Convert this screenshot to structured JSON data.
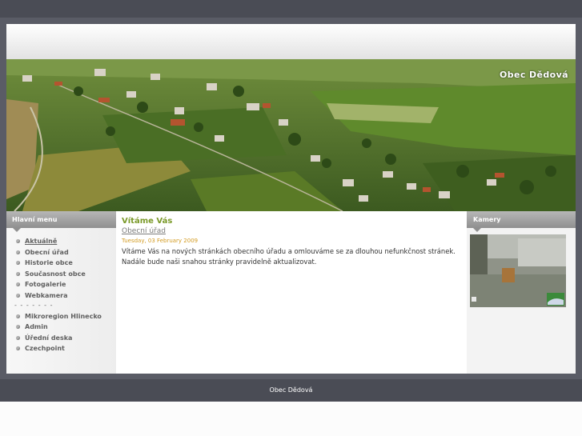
{
  "header": {
    "site_title": "Obec Dědová"
  },
  "sidebar": {
    "title": "Hlavní menu",
    "items": [
      {
        "label": "Aktuálně",
        "active": true
      },
      {
        "label": "Obecní úřad"
      },
      {
        "label": "Historie obce"
      },
      {
        "label": "Současnost obce"
      },
      {
        "label": "Fotogalerie"
      },
      {
        "label": "Webkamera"
      },
      {
        "label": "- - - - - - -",
        "separator": true
      },
      {
        "label": "Mikroregion Hlinecko"
      },
      {
        "label": "Admin"
      },
      {
        "label": "Úřední deska"
      },
      {
        "label": "Czechpoint"
      }
    ]
  },
  "article": {
    "title": "Vítáme Vás",
    "category": "Obecní úřad",
    "date": "Tuesday, 03 February 2009",
    "body": "Vítáme Vás na nových stránkách obecního úřadu  a omlouváme se za dlouhou nefunkčnost stránek. Nadále bude naši snahou stránky pravidelně aktualizovat."
  },
  "right_panel": {
    "title": "Kamery"
  },
  "footer": {
    "text": "Obec Dědová"
  },
  "colors": {
    "frame": "#5a5c66",
    "accent_green": "#7b9a2a",
    "date_orange": "#d39b21"
  }
}
